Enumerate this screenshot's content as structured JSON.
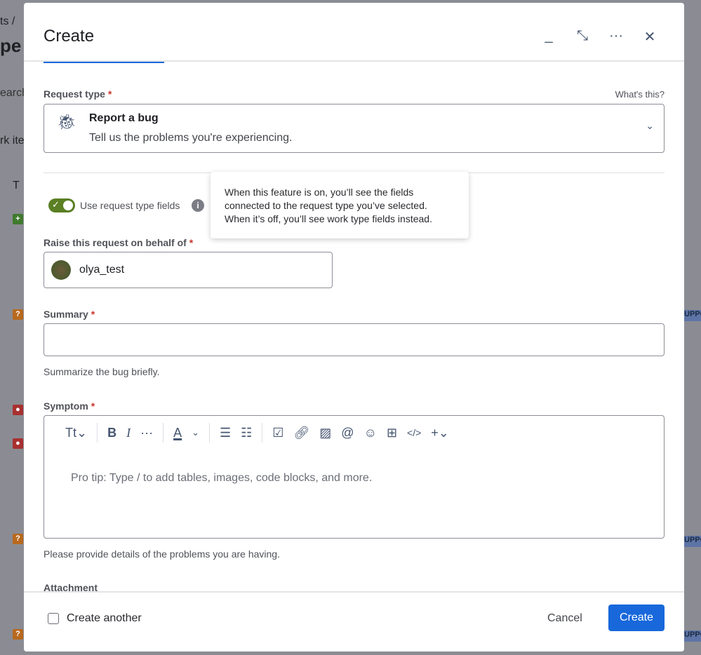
{
  "background": {
    "breadcrumb": "ts  /",
    "heading": "pe",
    "search": "earch",
    "work_items": "rk ite",
    "column_t": "T",
    "tag": "UPPO"
  },
  "modal": {
    "title": "Create",
    "request_type": {
      "label": "Request type",
      "whats_this": "What's this?",
      "name": "Report a bug",
      "description": "Tell us the problems you're experiencing."
    },
    "toggle": {
      "label": "Use request type fields",
      "on": true
    },
    "tooltip": "When this feature is on, you’ll see the fields connected to the request type you’ve selected. When it’s off, you’ll see work type fields instead.",
    "behalf": {
      "label": "Raise this request on behalf of",
      "value": "olya_test"
    },
    "summary": {
      "label": "Summary",
      "value": "",
      "help": "Summarize the bug briefly."
    },
    "symptom": {
      "label": "Symptom",
      "placeholder": "Pro tip: Type / to add tables, images, code blocks, and more.",
      "help": "Please provide details of the problems you are having."
    },
    "attachment": {
      "label": "Attachment"
    },
    "footer": {
      "create_another": "Create another",
      "cancel": "Cancel",
      "create": "Create"
    }
  },
  "colors": {
    "accent": "#1868db",
    "toggle": "#5b7f24",
    "required": "#c9372c"
  }
}
